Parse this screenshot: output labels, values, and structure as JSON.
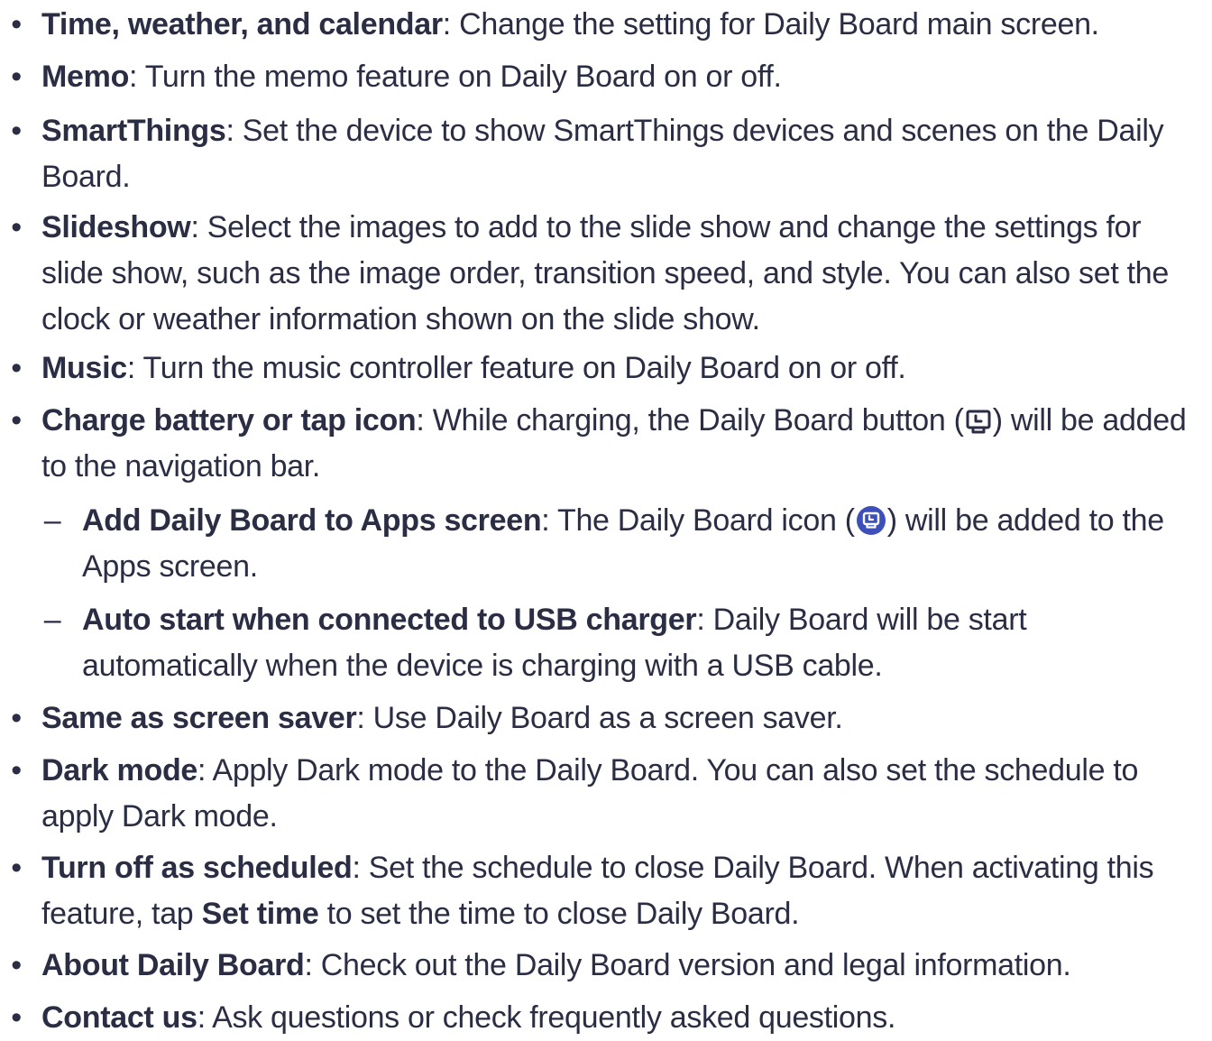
{
  "items": [
    {
      "term": "Time, weather, and calendar",
      "text": ": Change the setting for Daily Board main screen."
    },
    {
      "term": "Memo",
      "text": ": Turn the memo feature on Daily Board on or off."
    },
    {
      "term": "SmartThings",
      "text": ": Set the device to show SmartThings devices and scenes on the Daily Board."
    },
    {
      "term": "Slideshow",
      "text": ": Select the images to add to the slide show and change the settings for slide show, such as the image order, transition speed, and style. You can also set the clock or weather information shown on the slide show."
    },
    {
      "term": "Music",
      "text": ": Turn the music controller feature on Daily Board on or off."
    },
    {
      "term": "Charge battery or tap icon",
      "text_before": ": While charging, the Daily Board button (",
      "text_after": ") will be added to the navigation bar.",
      "icon": "daily-board-button-icon"
    },
    {
      "term": "Add Daily Board to Apps screen",
      "text_before": ": The Daily Board icon (",
      "text_after": ") will be added to the Apps screen.",
      "icon": "daily-board-app-icon",
      "icon_color": "#3d4fb8"
    },
    {
      "term": "Auto start when connected to USB charger",
      "text": ": Daily Board will be start automatically when the device is charging with a USB cable."
    },
    {
      "term": "Same as screen saver",
      "text": ": Use Daily Board as a screen saver."
    },
    {
      "term": "Dark mode",
      "text": ": Apply Dark mode to the Daily Board. You can also set the schedule to apply Dark mode."
    },
    {
      "term": "Turn off as scheduled",
      "text_before": ": Set the schedule to close Daily Board. When activating this feature, tap ",
      "inline_bold": "Set time",
      "text_after": " to set the time to close Daily Board."
    },
    {
      "term": "About Daily Board",
      "text": ": Check out the Daily Board version and legal information."
    },
    {
      "term": "Contact us",
      "text": ": Ask questions or check frequently asked questions."
    }
  ],
  "markers": {
    "bullet": "•",
    "dash": "–"
  },
  "colors": {
    "text": "#2a2d43",
    "app_icon": "#3d4fb8"
  }
}
